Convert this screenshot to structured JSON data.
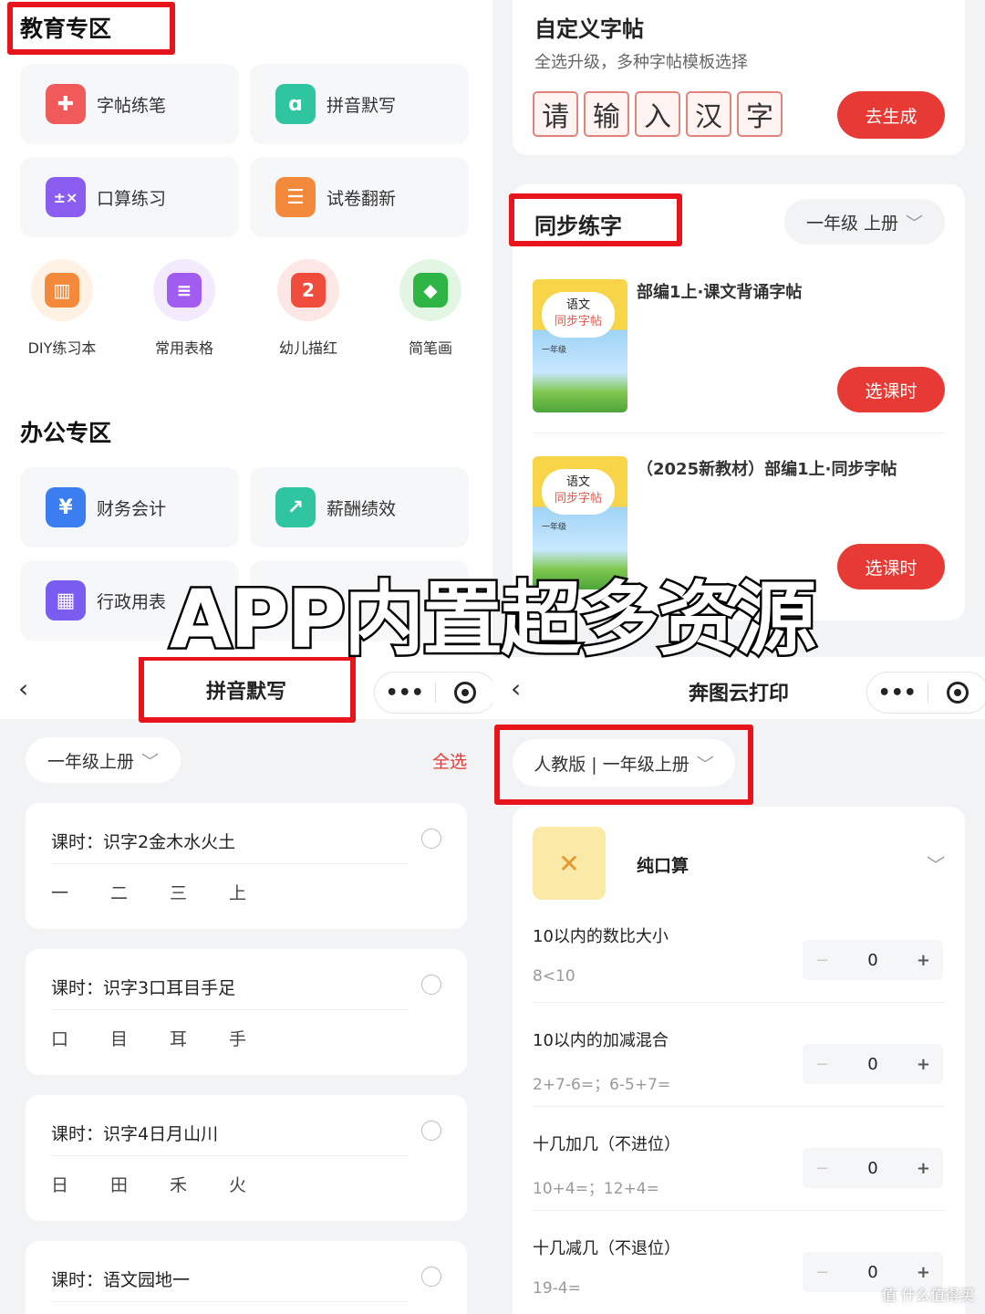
{
  "edu": {
    "title": "教育专区",
    "cards": [
      {
        "label": "字帖练笔",
        "icon": "copybook-icon",
        "color": "#f05a5a"
      },
      {
        "label": "拼音默写",
        "icon": "pinyin-icon",
        "color": "#2ec5a0"
      },
      {
        "label": "口算练习",
        "icon": "calculator-icon",
        "color": "#8a5cf0"
      },
      {
        "label": "试卷翻新",
        "icon": "exam-paper-icon",
        "color": "#f3893a"
      }
    ],
    "circles": [
      {
        "label": "DIY练习本",
        "icon": "notebook-icon",
        "color": "#f3893a",
        "bg": "#fff1e4"
      },
      {
        "label": "常用表格",
        "icon": "list-icon",
        "color": "#a35cf0",
        "bg": "#f4eafe"
      },
      {
        "label": "幼儿描红",
        "icon": "trace-icon",
        "color": "#ef4c3c",
        "bg": "#fde7e4"
      },
      {
        "label": "简笔画",
        "icon": "drawing-icon",
        "color": "#2fb545",
        "bg": "#e3f6e4"
      }
    ]
  },
  "office": {
    "title": "办公专区",
    "cards": [
      {
        "label": "财务会计",
        "icon": "finance-icon",
        "color": "#3a7ef2"
      },
      {
        "label": "薪酬绩效",
        "icon": "salary-chart-icon",
        "color": "#2ec5a0"
      },
      {
        "label": "行政用表",
        "icon": "grid-table-icon",
        "color": "#7b5cf0"
      }
    ]
  },
  "custom": {
    "title": "自定义字帖",
    "subtitle": "全选升级，多种字帖模板选择",
    "chars": [
      "请",
      "输",
      "入",
      "汉",
      "字"
    ],
    "generate_label": "去生成"
  },
  "sync": {
    "title": "同步练字",
    "grade": "一年级 上册",
    "books": [
      {
        "title": "部编1上·课文背诵字帖",
        "cover_line1": "语文",
        "cover_line2": "同步字帖",
        "cover_grade": "一年级",
        "button": "选课时"
      },
      {
        "title": "（2025新教材）部编1上·同步字帖",
        "cover_line1": "语文",
        "cover_line2": "同步字帖",
        "cover_grade": "一年级",
        "button": "选课时"
      }
    ]
  },
  "overlay_text": "APP内置超多资源",
  "pinyin": {
    "title": "拼音默写",
    "grade": "一年级上册",
    "select_all": "全选",
    "lessons": [
      {
        "title": "课时：识字2金木水火土",
        "chars": [
          "一",
          "二",
          "三",
          "上"
        ]
      },
      {
        "title": "课时：识字3口耳目手足",
        "chars": [
          "口",
          "目",
          "耳",
          "手"
        ]
      },
      {
        "title": "课时：识字4日月山川",
        "chars": [
          "日",
          "田",
          "禾",
          "火"
        ]
      },
      {
        "title": "课时：语文园地一",
        "chars": []
      }
    ]
  },
  "print": {
    "title": "奔图云打印",
    "edition": "人教版 | 一年级上册",
    "section": "纯口算",
    "items": [
      {
        "name": "10以内的数比大小",
        "example": "8<10",
        "count": "0"
      },
      {
        "name": "10以内的加减混合",
        "example": "2+7-6=；6-5+7=",
        "count": "0"
      },
      {
        "name": "十几加几（不进位）",
        "example": "10+4=；12+4=",
        "count": "0"
      },
      {
        "name": "十几减几（不退位）",
        "example": "19-4=",
        "count": "0"
      }
    ]
  },
  "watermark": "值 什么值得买",
  "icons": {
    "back": "back-icon",
    "more": "more-icon",
    "close": "target-icon",
    "chevron": "chevron-down-icon"
  },
  "colors": {
    "accent": "#e83a34",
    "highlight": "#e8141c"
  }
}
